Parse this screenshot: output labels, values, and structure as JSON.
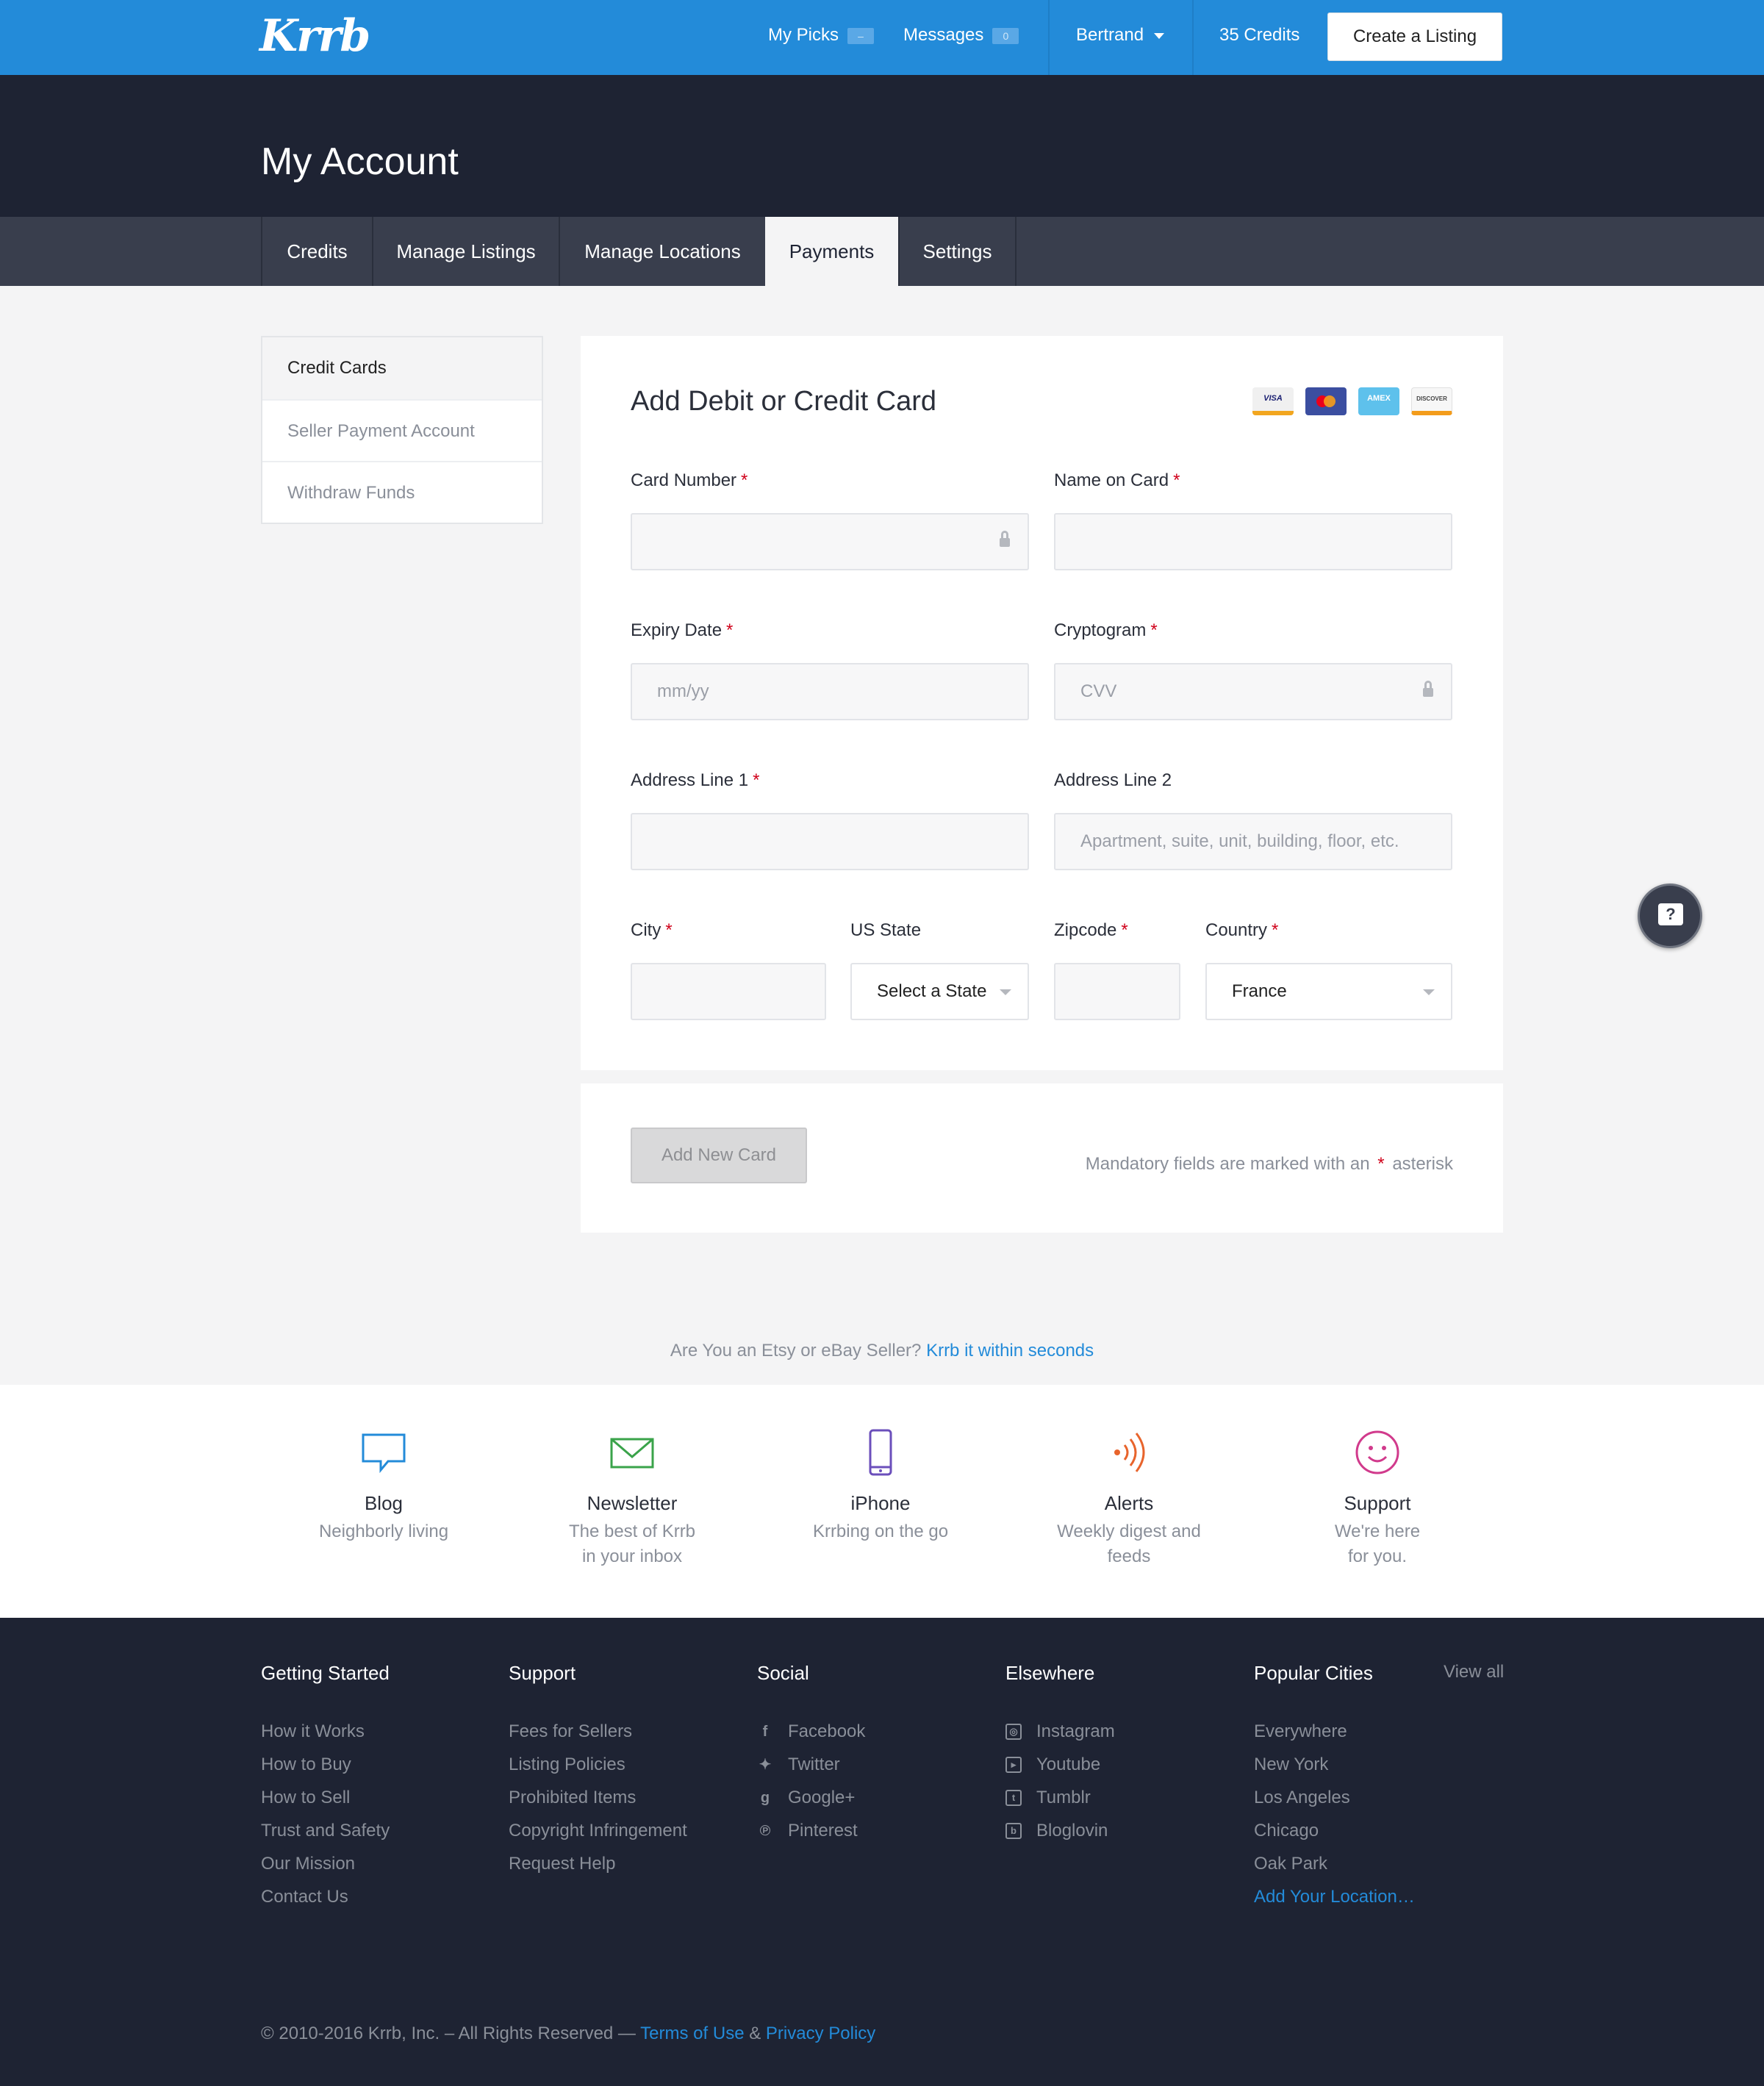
{
  "brand": {
    "logo": "Krrb"
  },
  "topnav": {
    "my_picks": "My Picks",
    "my_picks_count": "–",
    "messages": "Messages",
    "messages_count": "0",
    "user": "Bertrand",
    "credits": "35 Credits",
    "create_listing": "Create a Listing"
  },
  "header": {
    "title": "My Account"
  },
  "tabs": [
    {
      "label": "Credits"
    },
    {
      "label": "Manage Listings"
    },
    {
      "label": "Manage Locations"
    },
    {
      "label": "Payments",
      "active": true
    },
    {
      "label": "Settings"
    }
  ],
  "sidemenu": [
    {
      "label": "Credit Cards",
      "active": true
    },
    {
      "label": "Seller Payment Account"
    },
    {
      "label": "Withdraw Funds"
    }
  ],
  "form": {
    "title": "Add Debit or Credit Card",
    "card_icons": [
      "VISA",
      "MC",
      "AMEX",
      "DISCOVER"
    ],
    "card_number": {
      "label": "Card Number",
      "value": ""
    },
    "name_on_card": {
      "label": "Name on Card",
      "value": ""
    },
    "expiry": {
      "label": "Expiry Date",
      "placeholder": "mm/yy"
    },
    "cryptogram": {
      "label": "Cryptogram",
      "placeholder": "CVV"
    },
    "address1": {
      "label": "Address Line 1",
      "value": ""
    },
    "address2": {
      "label": "Address Line 2",
      "placeholder": "Apartment, suite, unit, building, floor, etc."
    },
    "city": {
      "label": "City",
      "value": ""
    },
    "us_state": {
      "label": "US State",
      "value": "Select a State"
    },
    "zipcode": {
      "label": "Zipcode",
      "value": ""
    },
    "country": {
      "label": "Country",
      "value": "France"
    },
    "required_mark": "*",
    "submit": "Add New Card",
    "mandatory_note_pre": "Mandatory fields are marked with an",
    "mandatory_note_post": "asterisk"
  },
  "etsy": {
    "text": "Are You an Etsy or eBay Seller?",
    "link": "Krrb it within seconds"
  },
  "features": [
    {
      "icon": "speech-bubble-icon",
      "title": "Blog",
      "sub1": "Neighborly living",
      "sub2": "",
      "color": "#238bd9"
    },
    {
      "icon": "envelope-icon",
      "title": "Newsletter",
      "sub1": "The best of Krrb",
      "sub2": "in your inbox",
      "color": "#3aa34a"
    },
    {
      "icon": "phone-icon",
      "title": "iPhone",
      "sub1": "Krrbing on the go",
      "sub2": "",
      "color": "#6b4fbb"
    },
    {
      "icon": "signal-icon",
      "title": "Alerts",
      "sub1": "Weekly digest and",
      "sub2": "feeds",
      "color": "#e8642c"
    },
    {
      "icon": "smiley-icon",
      "title": "Support",
      "sub1": "We're here",
      "sub2": "for you.",
      "color": "#d13a8c"
    }
  ],
  "footer": {
    "getting_started": {
      "title": "Getting Started",
      "links": [
        "How it Works",
        "How to Buy",
        "How to Sell",
        "Trust and Safety",
        "Our Mission",
        "Contact Us"
      ]
    },
    "support": {
      "title": "Support",
      "links": [
        "Fees for Sellers",
        "Listing Policies",
        "Prohibited Items",
        "Copyright Infringement",
        "Request Help"
      ]
    },
    "social": {
      "title": "Social",
      "links": [
        "Facebook",
        "Twitter",
        "Google+",
        "Pinterest"
      ]
    },
    "elsewhere": {
      "title": "Elsewhere",
      "links": [
        "Instagram",
        "Youtube",
        "Tumblr",
        "Bloglovin"
      ]
    },
    "cities": {
      "title": "Popular Cities",
      "view_all": "View all",
      "links": [
        "Everywhere",
        "New York",
        "Los Angeles",
        "Chicago",
        "Oak Park"
      ],
      "add_location": "Add Your Location…"
    },
    "copyright": "© 2010-2016 Krrb, Inc. – All Rights Reserved —",
    "terms": "Terms of Use",
    "amp": "&",
    "privacy": "Privacy Policy"
  },
  "help": {
    "glyph": "?"
  }
}
